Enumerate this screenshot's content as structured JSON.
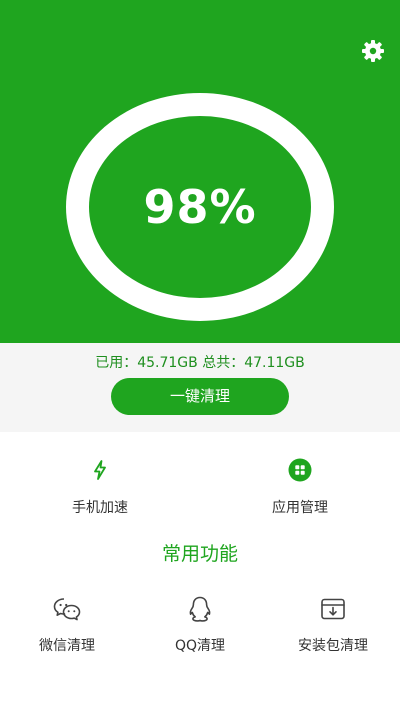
{
  "hero": {
    "percent": "98%",
    "settings_icon": "gear-icon",
    "bg_color": "#1fa51f"
  },
  "storage": {
    "used_label": "已用：",
    "used_value": "45.71GB",
    "total_label": "总共：",
    "total_value": "47.11GB"
  },
  "clean_button": {
    "label": "一键清理"
  },
  "quick_actions": [
    {
      "label": "手机加速",
      "icon": "lightning-icon"
    },
    {
      "label": "应用管理",
      "icon": "apps-grid-icon"
    }
  ],
  "section_title": "常用功能",
  "features": [
    {
      "label": "微信清理",
      "icon": "wechat-icon"
    },
    {
      "label": "QQ清理",
      "icon": "qq-penguin-icon"
    },
    {
      "label": "安装包清理",
      "icon": "package-box-icon"
    }
  ]
}
